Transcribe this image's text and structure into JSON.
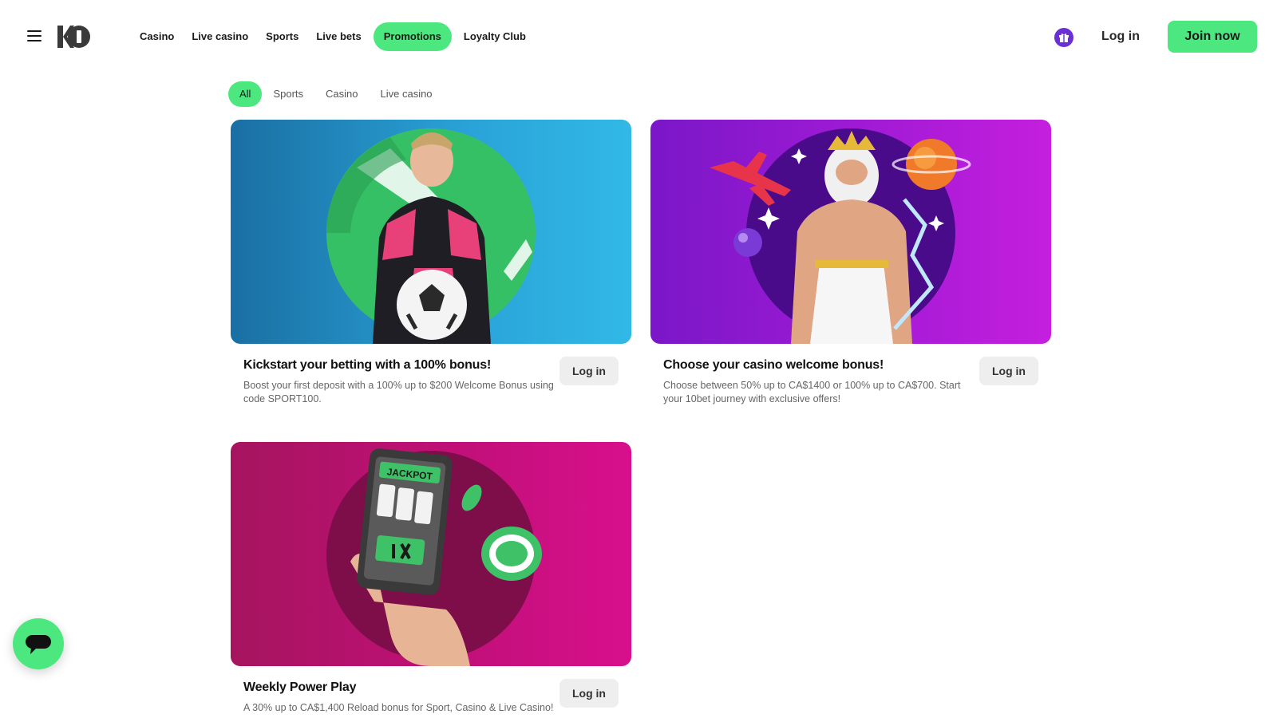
{
  "header": {
    "menu_icon": "hamburger-icon",
    "logo_text": "10BET",
    "nav": [
      {
        "label": "Casino",
        "active": false
      },
      {
        "label": "Live casino",
        "active": false
      },
      {
        "label": "Sports",
        "active": false
      },
      {
        "label": "Live bets",
        "active": false
      },
      {
        "label": "Promotions",
        "active": true
      },
      {
        "label": "Loyalty Club",
        "active": false
      }
    ],
    "gift_icon": "gift-icon",
    "login_label": "Log in",
    "join_label": "Join now"
  },
  "filters": [
    {
      "label": "All",
      "active": true
    },
    {
      "label": "Sports",
      "active": false
    },
    {
      "label": "Casino",
      "active": false
    },
    {
      "label": "Live casino",
      "active": false
    }
  ],
  "promotions": [
    {
      "title": "Kickstart your betting with a 100% bonus!",
      "description": "Boost your first deposit with a 100% up to $200 Welcome Bonus using code SPORT100.",
      "button_label": "Log in"
    },
    {
      "title": "Choose your casino welcome bonus!",
      "description": "Choose between 50% up to CA$1400 or 100% up to CA$700. Start your 10bet journey with exclusive offers!",
      "button_label": "Log in"
    },
    {
      "title": "Weekly Power Play",
      "description": "A 30% up to CA$1,400 Reload bonus for Sport, Casino & Live Casino!",
      "button_label": "Log in",
      "image_text": "JACKPOT"
    }
  ],
  "chat_icon": "chat-bubble-icon",
  "colors": {
    "accent": "#4ce87f",
    "gift": "#6b2fd6",
    "card1_bg": "#2aa3d8",
    "card2_bg": "#a51bd6",
    "card3_bg": "#c2107a"
  }
}
